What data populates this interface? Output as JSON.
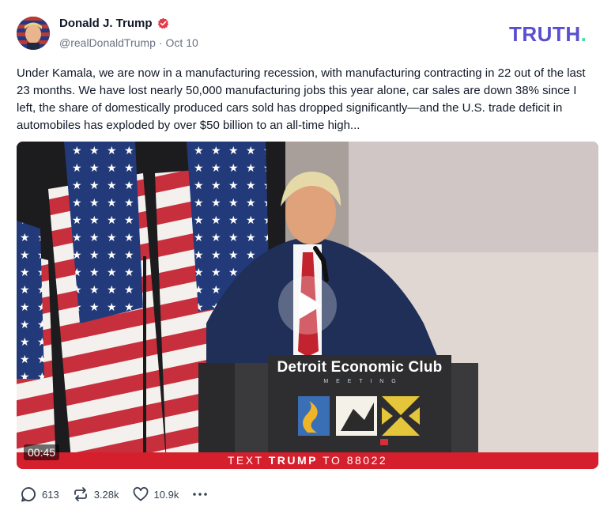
{
  "author": {
    "display_name": "Donald J. Trump",
    "handle": "@realDonaldTrump",
    "date": "Oct 10",
    "separator": "·"
  },
  "brand": {
    "logo_text": "TRUTH.",
    "color": "#5a4fcf",
    "dot_color": "#4ad9b0"
  },
  "post": {
    "text": "Under Kamala, we are now in a manufacturing recession, with manufacturing contracting in 22 out of the last 23 months. We have lost nearly 50,000 manufacturing jobs this year alone, car sales are down 38% since I left, the share of domestically produced cars sold has dropped significantly—and the U.S. trade deficit in automobiles has exploded by over $50 billion to an all-time high..."
  },
  "video": {
    "duration": "00:45",
    "podium_label": "Detroit Economic Club",
    "podium_sub": "M E E T I N G",
    "banner_prefix": "TEXT ",
    "banner_bold": "TRUMP",
    "banner_suffix": " TO 88022",
    "banner_color": "#d61f2c"
  },
  "actions": {
    "replies": "613",
    "retruths": "3.28k",
    "likes": "10.9k"
  },
  "icons": [
    "verified-badge-icon",
    "play-icon",
    "reply-icon",
    "retruth-icon",
    "like-icon",
    "more-icon"
  ]
}
